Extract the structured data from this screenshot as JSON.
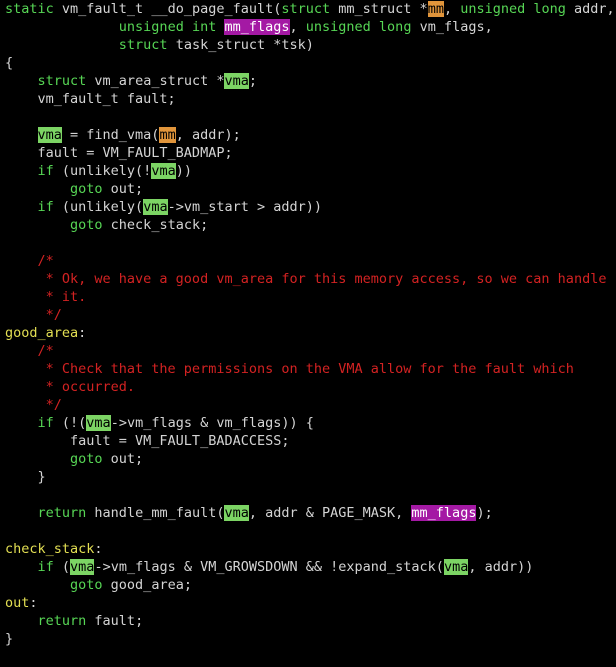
{
  "editor": {
    "lines": [
      [
        [
          "kw",
          "static"
        ],
        [
          "t",
          " vm_fault_t __do_page_fault("
        ],
        [
          "kw",
          "struct"
        ],
        [
          "t",
          " mm_struct *"
        ],
        [
          "hl-mm",
          "mm"
        ],
        [
          "t",
          ", "
        ],
        [
          "kw",
          "unsigned long"
        ],
        [
          "t",
          " addr,"
        ]
      ],
      [
        [
          "t",
          "              "
        ],
        [
          "kw",
          "unsigned int"
        ],
        [
          "t",
          " "
        ],
        [
          "hl-flags",
          "mm_flags"
        ],
        [
          "t",
          ", "
        ],
        [
          "kw",
          "unsigned long"
        ],
        [
          "t",
          " vm_flags,"
        ]
      ],
      [
        [
          "t",
          "              "
        ],
        [
          "kw",
          "struct"
        ],
        [
          "t",
          " task_struct *tsk)"
        ]
      ],
      [
        [
          "t",
          "{"
        ]
      ],
      [
        [
          "t",
          "    "
        ],
        [
          "kw",
          "struct"
        ],
        [
          "t",
          " vm_area_struct *"
        ],
        [
          "hl-vma",
          "vma"
        ],
        [
          "t",
          ";"
        ]
      ],
      [
        [
          "t",
          "    vm_fault_t fault;"
        ]
      ],
      [],
      [
        [
          "t",
          "    "
        ],
        [
          "hl-vma",
          "vma"
        ],
        [
          "t",
          " = find_vma("
        ],
        [
          "hl-mm",
          "mm"
        ],
        [
          "t",
          ", addr);"
        ]
      ],
      [
        [
          "t",
          "    fault = VM_FAULT_BADMAP;"
        ]
      ],
      [
        [
          "t",
          "    "
        ],
        [
          "kw",
          "if"
        ],
        [
          "t",
          " (unlikely(!"
        ],
        [
          "hl-vma",
          "vma"
        ],
        [
          "t",
          "))"
        ]
      ],
      [
        [
          "t",
          "        "
        ],
        [
          "kw",
          "goto"
        ],
        [
          "t",
          " out;"
        ]
      ],
      [
        [
          "t",
          "    "
        ],
        [
          "kw",
          "if"
        ],
        [
          "t",
          " (unlikely("
        ],
        [
          "hl-vma",
          "vma"
        ],
        [
          "t",
          "->vm_start > addr))"
        ]
      ],
      [
        [
          "t",
          "        "
        ],
        [
          "kw",
          "goto"
        ],
        [
          "t",
          " check_stack;"
        ]
      ],
      [],
      [
        [
          "cm",
          "    /*"
        ]
      ],
      [
        [
          "cm",
          "     * Ok, we have a good vm_area for this memory access, so we can handle"
        ]
      ],
      [
        [
          "cm",
          "     * it."
        ]
      ],
      [
        [
          "cm",
          "     */"
        ]
      ],
      [
        [
          "lbl",
          "good_area"
        ],
        [
          "t",
          ":"
        ]
      ],
      [
        [
          "cm",
          "    /*"
        ]
      ],
      [
        [
          "cm",
          "     * Check that the permissions on the VMA allow for the fault which"
        ]
      ],
      [
        [
          "cm",
          "     * occurred."
        ]
      ],
      [
        [
          "cm",
          "     */"
        ]
      ],
      [
        [
          "t",
          "    "
        ],
        [
          "kw",
          "if"
        ],
        [
          "t",
          " (!("
        ],
        [
          "hl-vma",
          "vma"
        ],
        [
          "t",
          "->vm_flags & vm_flags)) {"
        ]
      ],
      [
        [
          "t",
          "        fault = VM_FAULT_BADACCESS;"
        ]
      ],
      [
        [
          "t",
          "        "
        ],
        [
          "kw",
          "goto"
        ],
        [
          "t",
          " out;"
        ]
      ],
      [
        [
          "t",
          "    }"
        ]
      ],
      [],
      [
        [
          "t",
          "    "
        ],
        [
          "kw",
          "return"
        ],
        [
          "t",
          " handle_mm_fault("
        ],
        [
          "hl-vma",
          "vma"
        ],
        [
          "t",
          ", addr & PAGE_MASK, "
        ],
        [
          "hl-flags",
          "mm_flags"
        ],
        [
          "t",
          ");"
        ]
      ],
      [],
      [
        [
          "lbl",
          "check_stack"
        ],
        [
          "t",
          ":"
        ]
      ],
      [
        [
          "t",
          "    "
        ],
        [
          "kw",
          "if"
        ],
        [
          "t",
          " ("
        ],
        [
          "hl-vma",
          "vma"
        ],
        [
          "t",
          "->vm_flags & VM_GROWSDOWN && !expand_stack("
        ],
        [
          "hl-vma",
          "vma"
        ],
        [
          "t",
          ", addr))"
        ]
      ],
      [
        [
          "t",
          "        "
        ],
        [
          "kw",
          "goto"
        ],
        [
          "t",
          " good_area;"
        ]
      ],
      [
        [
          "lbl",
          "out"
        ],
        [
          "t",
          ":"
        ]
      ],
      [
        [
          "t",
          "    "
        ],
        [
          "kw",
          "return"
        ],
        [
          "t",
          " fault;"
        ]
      ],
      [
        [
          "t",
          "}"
        ]
      ]
    ]
  },
  "colors": {
    "background": "#000000",
    "text": "#d4d4d4",
    "keyword": "#57d655",
    "label": "#e3df53",
    "comment": "#d32222",
    "highlight_vma": "#7cd464",
    "highlight_mm": "#e1953b",
    "highlight_mm_flags": "#a419a4"
  }
}
